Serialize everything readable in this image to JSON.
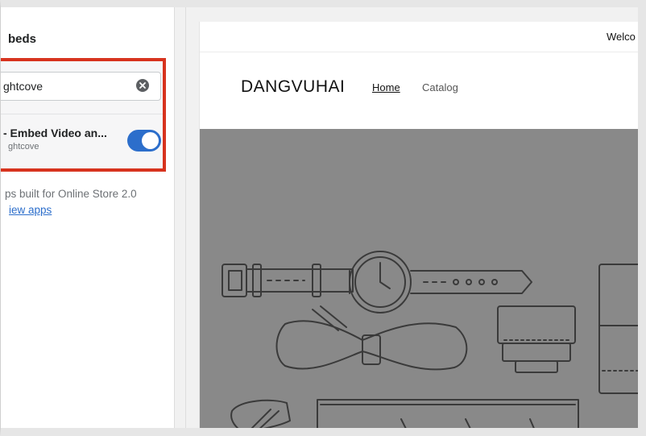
{
  "sidebar": {
    "title": "beds",
    "search": {
      "value": "ghtcove",
      "placeholder": ""
    },
    "app": {
      "name": "- Embed Video an...",
      "vendor": "ghtcove",
      "enabled": true
    },
    "info_text": "ps built for Online Store 2.0",
    "view_apps_link": "iew apps"
  },
  "preview": {
    "announcement": "Welco",
    "logo": "DANGVUHAI",
    "nav": {
      "home": "Home",
      "catalog": "Catalog"
    }
  },
  "colors": {
    "highlight": "#d7331e",
    "toggle_on": "#2c6ecb",
    "link": "#2c6ecb",
    "hero_bg": "#898989"
  },
  "icons": {
    "clear": "clear-icon"
  }
}
